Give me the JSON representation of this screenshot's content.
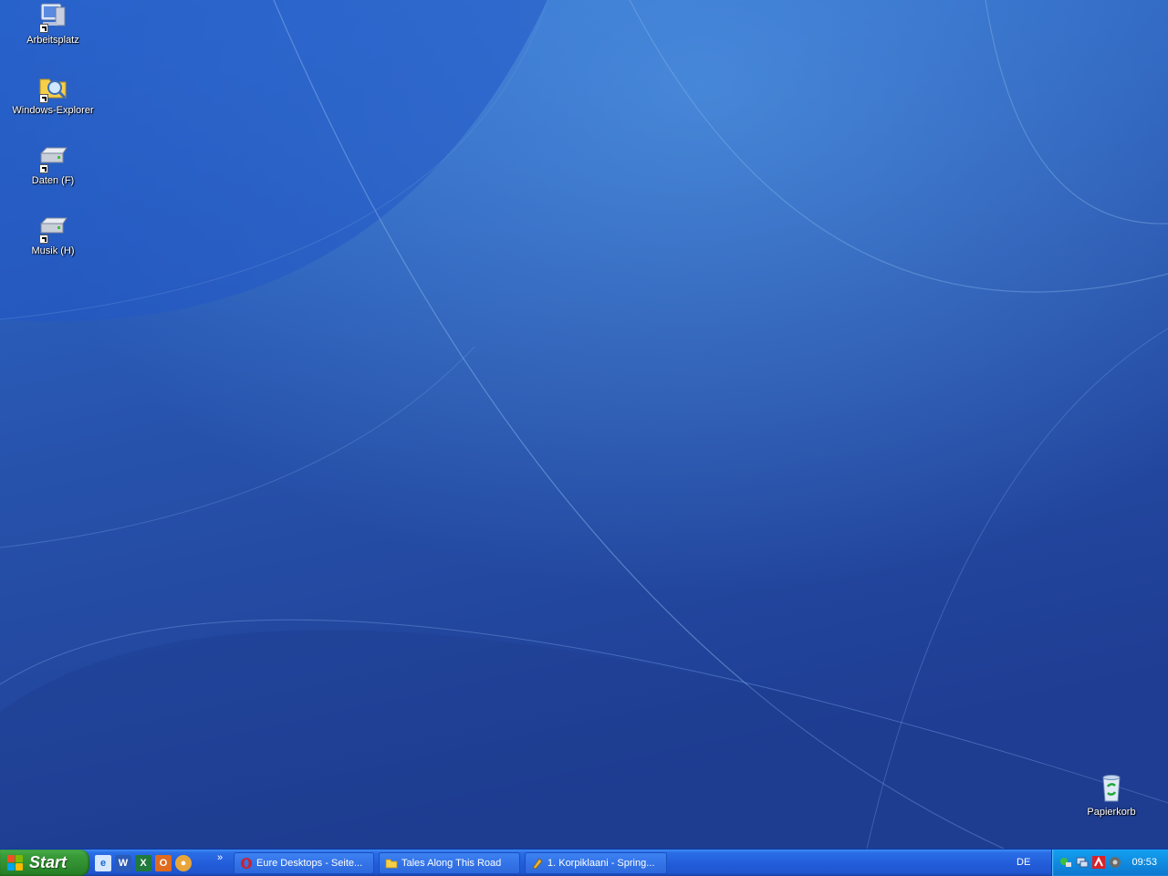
{
  "desktop": {
    "icons": [
      {
        "label": "Arbeitsplatz",
        "icon": "my-computer-icon"
      },
      {
        "label": "Windows-Explorer",
        "icon": "explorer-icon"
      },
      {
        "label": "Daten (F)",
        "icon": "drive-icon"
      },
      {
        "label": "Musik (H)",
        "icon": "drive-icon"
      }
    ],
    "recycle_bin": {
      "label": "Papierkorb",
      "icon": "recycle-bin-icon"
    }
  },
  "taskbar": {
    "start_label": "Start",
    "quick_launch": [
      {
        "name": "internet-explorer",
        "icon": "ie-icon"
      },
      {
        "name": "word",
        "icon": "word-icon"
      },
      {
        "name": "excel",
        "icon": "excel-icon"
      },
      {
        "name": "outlook",
        "icon": "outlook-icon"
      },
      {
        "name": "media",
        "icon": "media-icon"
      }
    ],
    "quick_launch_more": "»",
    "tasks": [
      {
        "label": "Eure Desktops - Seite...",
        "icon": "opera-icon"
      },
      {
        "label": "Tales Along This Road",
        "icon": "folder-icon"
      },
      {
        "label": "1. Korpiklaani - Spring...",
        "icon": "winamp-icon"
      }
    ],
    "language": "DE",
    "clock": "09:53"
  },
  "colors": {
    "taskbar": "#245edb",
    "start": "#3a9c3a",
    "tray": "#0f8be0"
  }
}
